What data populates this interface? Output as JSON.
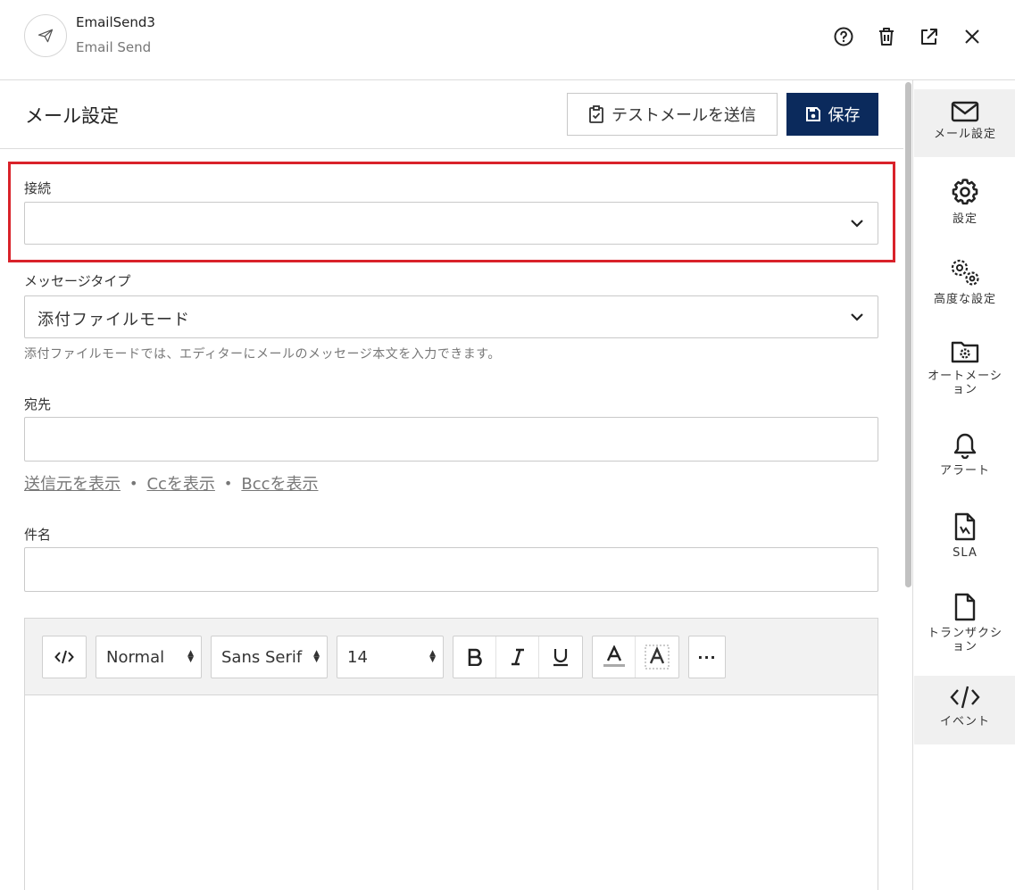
{
  "header": {
    "title": "EmailSend3",
    "subtitle": "Email Send",
    "icons": [
      "help-icon",
      "trash-icon",
      "external-link-icon",
      "close-icon"
    ]
  },
  "section": {
    "title": "メール設定",
    "test_button": "テストメールを送信",
    "save_button": "保存"
  },
  "form": {
    "connection_label": "接続",
    "connection_value": "",
    "message_type_label": "メッセージタイプ",
    "message_type_value": "添付ファイルモード",
    "message_type_hint": "添付ファイルモードでは、エディターにメールのメッセージ本文を入力できます。",
    "to_label": "宛先",
    "to_value": "",
    "show_from": "送信元を表示",
    "show_cc": "Ccを表示",
    "show_bcc": "Bccを表示",
    "subject_label": "件名",
    "subject_value": ""
  },
  "editor": {
    "format": "Normal",
    "font": "Sans Serif",
    "size": "14"
  },
  "rail": {
    "items": [
      {
        "label": "メール設定",
        "icon": "envelope-icon",
        "active": true
      },
      {
        "label": "設定",
        "icon": "gear-icon",
        "active": false
      },
      {
        "label": "高度な設定",
        "icon": "gears-icon",
        "active": false
      },
      {
        "label": "オートメーション",
        "icon": "folder-gear-icon",
        "active": false
      },
      {
        "label": "アラート",
        "icon": "bell-icon",
        "active": false
      },
      {
        "label": "SLA",
        "icon": "sla-document-icon",
        "active": false
      },
      {
        "label": "トランザクション",
        "icon": "document-icon",
        "active": false
      },
      {
        "label": "イベント",
        "icon": "code-icon",
        "active": true
      }
    ]
  },
  "colors": {
    "primary": "#0b2a5c",
    "highlight": "#d9222a",
    "rail_active": "#f0f0f0"
  }
}
